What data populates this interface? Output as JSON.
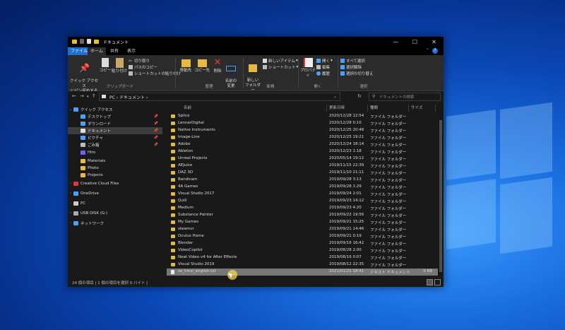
{
  "window": {
    "title": "ドキュメント",
    "controls": {
      "minimize": "—",
      "maximize": "☐",
      "close": "✕"
    }
  },
  "ribbon_tabs": [
    "ファイル",
    "ホーム",
    "共有",
    "表示"
  ],
  "ribbon": {
    "clipboard": {
      "label": "クリップボード",
      "quick_access": "クイック アクセス\nにピン留めする",
      "copy": "コピー",
      "paste": "貼り付け",
      "cut": "切り取り",
      "copy_path": "パスのコピー",
      "paste_shortcut": "ショートカットの貼り付け"
    },
    "organize": {
      "label": "整理",
      "move_to": "移動先",
      "copy_to": "コピー先",
      "delete": "削除",
      "rename": "名前の\n変更"
    },
    "new": {
      "label": "新規",
      "new_folder": "新しい\nフォルダー",
      "new_item": "新しいアイテム",
      "shortcut": "ショートカット"
    },
    "open": {
      "label": "開く",
      "properties": "プロパティ",
      "open": "開く",
      "edit": "編集",
      "history": "履歴"
    },
    "select": {
      "label": "選択",
      "select_all": "すべて選択",
      "select_none": "選択解除",
      "invert": "選択の切り替え"
    }
  },
  "address": {
    "path": "PC  ›  ドキュメント  ›",
    "search_placeholder": "ドキュメントの検索"
  },
  "sidebar": [
    {
      "label": "クイック アクセス",
      "icon": "star-icon",
      "pinned": false,
      "selected": false,
      "expanded": true
    },
    {
      "label": "デスクトップ",
      "icon": "desktop-icon",
      "pinned": true,
      "selected": false
    },
    {
      "label": "ダウンロード",
      "icon": "download-icon",
      "pinned": true,
      "selected": false
    },
    {
      "label": "ドキュメント",
      "icon": "documents-icon",
      "pinned": true,
      "selected": true
    },
    {
      "label": "ピクチャ",
      "icon": "pictures-icon",
      "pinned": true,
      "selected": false
    },
    {
      "label": "ごみ箱",
      "icon": "recycle-bin-icon",
      "pinned": true,
      "selected": false
    },
    {
      "label": "Hiro",
      "icon": "user-icon",
      "pinned": false,
      "selected": false
    },
    {
      "label": "Materials",
      "icon": "folder-icon",
      "pinned": false,
      "selected": false
    },
    {
      "label": "Photo",
      "icon": "folder-icon",
      "pinned": false,
      "selected": false
    },
    {
      "label": "Projects",
      "icon": "folder-icon",
      "pinned": false,
      "selected": false
    },
    {
      "label": "Creative Cloud Files",
      "icon": "creative-cloud-icon",
      "pinned": false,
      "selected": false
    },
    {
      "label": "OneDrive",
      "icon": "onedrive-icon",
      "pinned": false,
      "selected": false
    },
    {
      "label": "PC",
      "icon": "pc-icon",
      "pinned": false,
      "selected": false
    },
    {
      "label": "USB DISK (G:)",
      "icon": "usb-drive-icon",
      "pinned": false,
      "selected": false
    },
    {
      "label": "ネットワーク",
      "icon": "network-icon",
      "pinned": false,
      "selected": false
    }
  ],
  "columns": [
    "名前",
    "更新日時",
    "種類",
    "サイズ"
  ],
  "files": [
    {
      "name": "Splice",
      "date": "2020/12/28 12:54",
      "type": "ファイル フォルダー",
      "size": ""
    },
    {
      "name": "LennarDigital",
      "date": "2020/12/28 0:10",
      "type": "ファイル フォルダー",
      "size": ""
    },
    {
      "name": "Native Instruments",
      "date": "2020/12/25 20:48",
      "type": "ファイル フォルダー",
      "size": ""
    },
    {
      "name": "Image-Line",
      "date": "2020/12/25 19:21",
      "type": "ファイル フォルダー",
      "size": ""
    },
    {
      "name": "Adobe",
      "date": "2020/12/24 18:14",
      "type": "ファイル フォルダー",
      "size": ""
    },
    {
      "name": "Ableton",
      "date": "2020/12/23 1:18",
      "type": "ファイル フォルダー",
      "size": ""
    },
    {
      "name": "Unreal Projects",
      "date": "2020/05/14 19:12",
      "type": "ファイル フォルダー",
      "size": ""
    },
    {
      "name": "AEJuice",
      "date": "2019/11/15 22:39",
      "type": "ファイル フォルダー",
      "size": ""
    },
    {
      "name": "DAZ 3D",
      "date": "2019/11/10 21:11",
      "type": "ファイル フォルダー",
      "size": ""
    },
    {
      "name": "Bandicam",
      "date": "2019/09/28 3:13",
      "type": "ファイル フォルダー",
      "size": ""
    },
    {
      "name": "4A Games",
      "date": "2019/09/28 1:29",
      "type": "ファイル フォルダー",
      "size": ""
    },
    {
      "name": "Visual Studio 2017",
      "date": "2019/09/24 2:01",
      "type": "ファイル フォルダー",
      "size": ""
    },
    {
      "name": "Quill",
      "date": "2019/09/23 14:12",
      "type": "ファイル フォルダー",
      "size": ""
    },
    {
      "name": "Medium",
      "date": "2019/09/23 4:20",
      "type": "ファイル フォルダー",
      "size": ""
    },
    {
      "name": "Substance Painter",
      "date": "2019/09/22 19:56",
      "type": "ファイル フォルダー",
      "size": ""
    },
    {
      "name": "My Games",
      "date": "2019/09/21 15:25",
      "type": "ファイル フォルダー",
      "size": ""
    },
    {
      "name": "steamvr",
      "date": "2019/09/21 14:46",
      "type": "ファイル フォルダー",
      "size": ""
    },
    {
      "name": "Oculus Home",
      "date": "2019/09/21 0:19",
      "type": "ファイル フォルダー",
      "size": ""
    },
    {
      "name": "Blender",
      "date": "2019/09/16 16:42",
      "type": "ファイル フォルダー",
      "size": ""
    },
    {
      "name": "VideoCopilot",
      "date": "2019/08/28 2:00",
      "type": "ファイル フォルダー",
      "size": ""
    },
    {
      "name": "Neat Video v4 for After Effects",
      "date": "2019/08/16 0:07",
      "type": "ファイル フォルダー",
      "size": ""
    },
    {
      "name": "Visual Studio 2019",
      "date": "2019/08/12 22:35",
      "type": "ファイル フォルダー",
      "size": ""
    },
    {
      "name": "se_hinsi_english.txt",
      "date": "2021/01/21 18:41",
      "type": "テキスト ドキュメント",
      "size": "0 KB",
      "selected": true
    }
  ],
  "status": "24 個の項目  |  1 個の項目を選択  0 バイト  |",
  "colors": {
    "folder": "#e8b93c",
    "accent": "#1e6fd0",
    "window_bg": "#191919"
  }
}
